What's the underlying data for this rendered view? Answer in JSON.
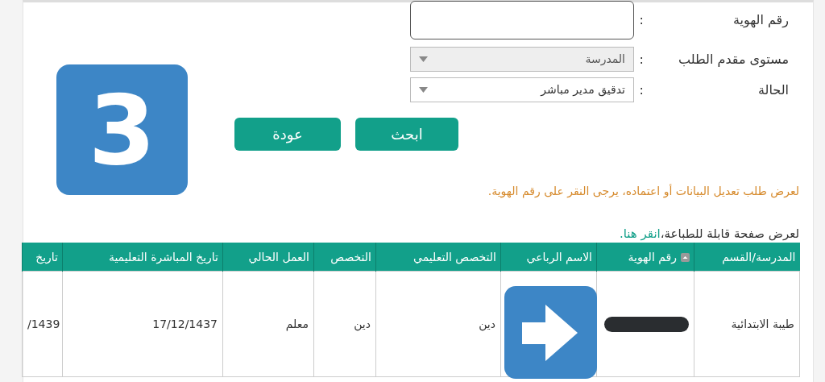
{
  "form": {
    "fields": [
      {
        "kind": "text",
        "label": "رقم الهوية",
        "colon": ":"
      },
      {
        "kind": "select",
        "label": "مستوى مقدم الطلب",
        "colon": ":",
        "value": "المدرسة",
        "disabled": true
      },
      {
        "kind": "select",
        "label": "الحالة",
        "colon": ":",
        "value": "تدقيق مدير مباشر",
        "disabled": false
      }
    ],
    "buttons": [
      "ابحث",
      "عودة"
    ]
  },
  "notice": "لعرض طلب تعديل البيانات أو اعتماده، يرجى النقر على رقم الهوية.",
  "print_hint": {
    "text": "لعرض صفحة قابلة للطباعة،",
    "link": "انقر هنا."
  },
  "table": {
    "columns": [
      {
        "label": "المدرسة/القسم",
        "sorted": false
      },
      {
        "label": "رقم الهوية",
        "sorted": true
      },
      {
        "label": "الاسم الرباعي",
        "sorted": false
      },
      {
        "label": "التخصص التعليمي",
        "sorted": false
      },
      {
        "label": "التخصص",
        "sorted": false
      },
      {
        "label": "العمل الحالي",
        "sorted": false
      },
      {
        "label": "تاريخ المباشرة التعليمية",
        "sorted": false
      },
      {
        "label": "تاريخ",
        "sorted": false
      }
    ],
    "rows": [
      {
        "cells": [
          {
            "kind": "text",
            "text": "طيبة الابتدائية"
          },
          {
            "kind": "redacted"
          },
          {
            "kind": "empty"
          },
          {
            "kind": "text",
            "text": "دين"
          },
          {
            "kind": "text",
            "text": "دين"
          },
          {
            "kind": "text",
            "text": "معلم"
          },
          {
            "kind": "text",
            "text": "17/12/1437"
          },
          {
            "kind": "text",
            "text": "/1439"
          }
        ]
      }
    ]
  },
  "overlays": [
    {
      "kind": "number",
      "text": "3"
    },
    {
      "kind": "arrow"
    }
  ]
}
